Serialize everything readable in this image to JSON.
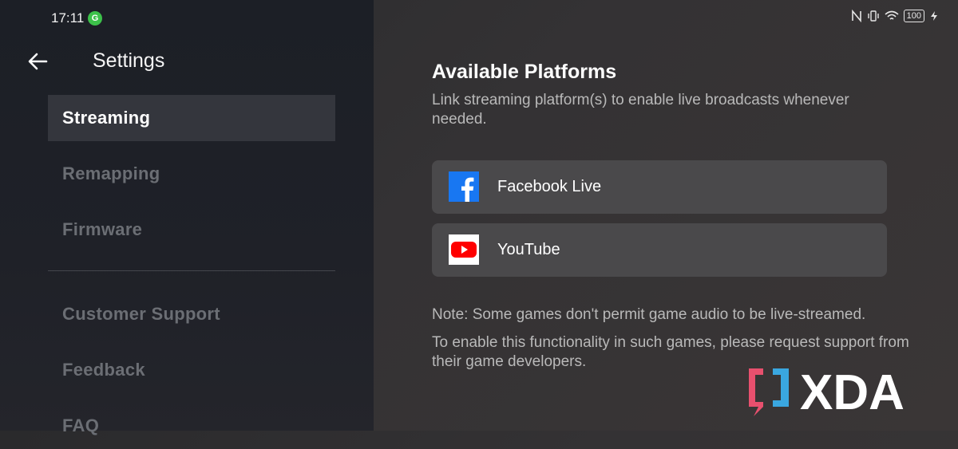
{
  "status_bar": {
    "time": "17:11",
    "notification_icon": "grammarly-g-icon",
    "battery": "100"
  },
  "sidebar": {
    "title": "Settings",
    "back_icon": "back-arrow-icon",
    "items": [
      {
        "label": "Streaming",
        "active": true
      },
      {
        "label": "Remapping",
        "active": false
      },
      {
        "label": "Firmware",
        "active": false
      }
    ],
    "support_items": [
      {
        "label": "Customer Support"
      },
      {
        "label": "Feedback"
      },
      {
        "label": "FAQ"
      }
    ]
  },
  "main": {
    "title": "Available Platforms",
    "subtitle": "Link streaming platform(s) to enable live broadcasts whenever needed.",
    "platforms": [
      {
        "label": "Facebook Live",
        "icon": "facebook-icon",
        "color": "#1877f2"
      },
      {
        "label": "YouTube",
        "icon": "youtube-icon",
        "color": "#ff0000"
      }
    ],
    "note1": "Note: Some games don't permit game audio to be live-streamed.",
    "note2": "To enable this functionality in such games, please request support from their game developers."
  },
  "watermark": {
    "text": "XDA"
  },
  "colors": {
    "sidebar_bg": "#1f2128",
    "active_item_bg": "#34363d",
    "card_bg": "#4a494b",
    "xda_pink": "#e8506e",
    "xda_blue": "#3aa7e0"
  }
}
